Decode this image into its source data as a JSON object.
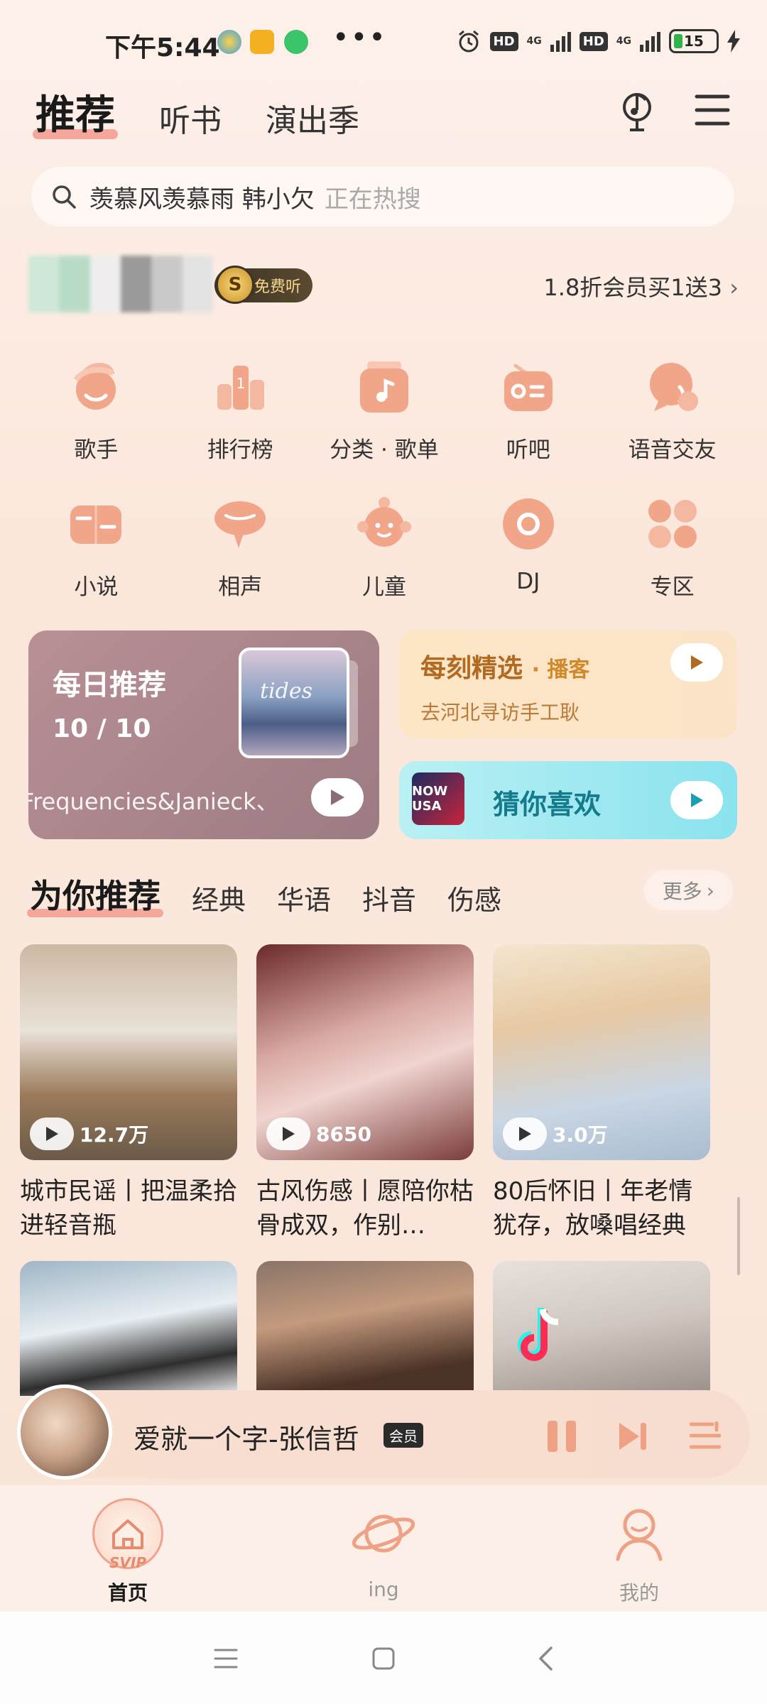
{
  "status_bar": {
    "time": "下午5:44",
    "network1": "4G",
    "network2": "4G",
    "hd1": "HD",
    "hd2": "HD",
    "battery": "15",
    "more": "•••"
  },
  "header": {
    "tabs": [
      "推荐",
      "听书",
      "演出季"
    ],
    "active_tab": 0
  },
  "search": {
    "query": "羡慕风羡慕雨  韩小欠",
    "hint": "正在热搜"
  },
  "vip": {
    "badge_letter": "S",
    "badge_text": "免费听",
    "promo": "1.8折会员买1送3"
  },
  "quick_links": [
    {
      "label": "歌手",
      "icon": "singer-icon"
    },
    {
      "label": "排行榜",
      "icon": "ranking-icon"
    },
    {
      "label": "分类 · 歌单",
      "icon": "playlist-category-icon"
    },
    {
      "label": "听吧",
      "icon": "radio-icon"
    },
    {
      "label": "语音交友",
      "icon": "voice-chat-icon"
    },
    {
      "label": "小说",
      "icon": "novel-icon"
    },
    {
      "label": "相声",
      "icon": "crosstalk-icon"
    },
    {
      "label": "儿童",
      "icon": "kids-icon"
    },
    {
      "label": "DJ",
      "icon": "dj-icon"
    },
    {
      "label": "专区",
      "icon": "zone-icon"
    }
  ],
  "daily": {
    "title": "每日推荐",
    "date": "10 / 10",
    "subtitle": "Frequencies&Janieck、",
    "cover_text": "tides"
  },
  "moment": {
    "title": "每刻精选",
    "tag": "· 播客",
    "subtitle": "去河北寻访手工耿"
  },
  "guess": {
    "title": "猜你喜欢",
    "thumb_text": "NOW USA"
  },
  "section": {
    "tabs": [
      "为你推荐",
      "经典",
      "华语",
      "抖音",
      "伤感"
    ],
    "more": "更多"
  },
  "playlists": [
    {
      "count": "12.7万",
      "title": "城市民谣丨把温柔拾进轻音瓶"
    },
    {
      "count": "8650",
      "title": "古风伤感丨愿陪你枯骨成双，作别…"
    },
    {
      "count": "3.0万",
      "title": "80后怀旧丨年老情犹存，放嗓唱经典"
    }
  ],
  "player": {
    "song": "爱就一个字-张信哲",
    "tag": "会员"
  },
  "bottom_nav": [
    {
      "label": "首页",
      "badge": "SVIP"
    },
    {
      "label": "ing"
    },
    {
      "label": "我的"
    }
  ],
  "colors": {
    "accent": "#f4a79a",
    "icon_orange": "#f1a68a",
    "card_gold": "#b16a1f",
    "card_teal": "#137b8c"
  }
}
